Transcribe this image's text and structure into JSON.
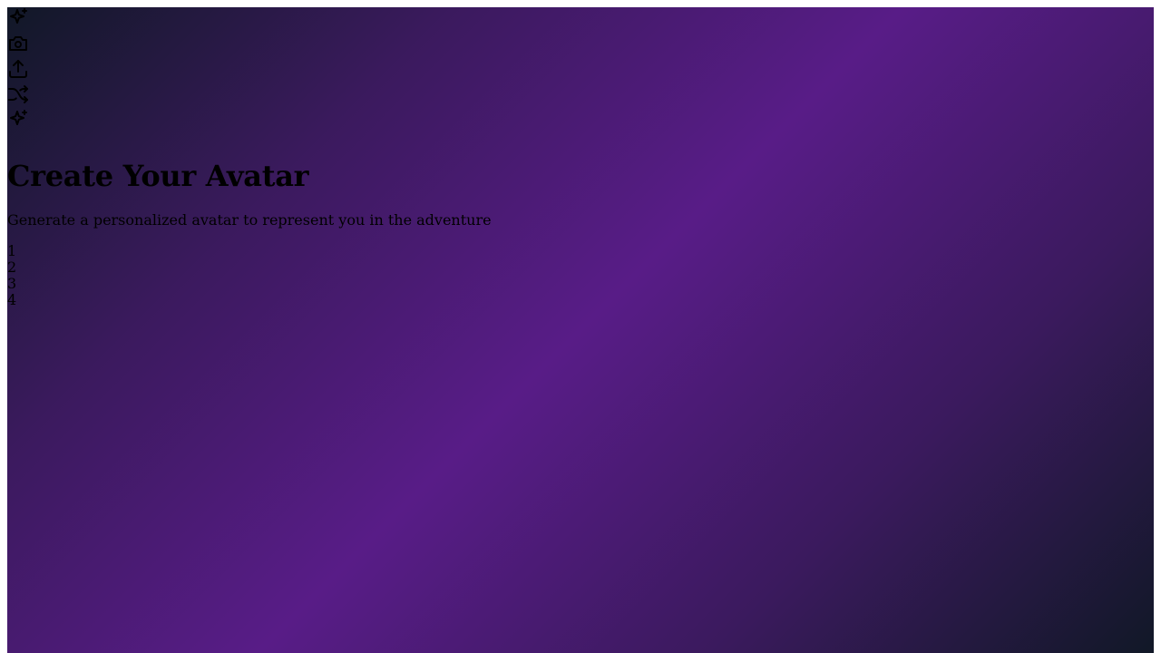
{
  "icons": [
    {
      "name": "sparkles-icon"
    },
    {
      "name": "camera-icon"
    },
    {
      "name": "upload-icon"
    },
    {
      "name": "shuffle-icon"
    },
    {
      "name": "sparkles-icon"
    }
  ],
  "header": {
    "title": "Create Your Avatar",
    "subtitle": "Generate a personalized avatar to represent you in the adventure"
  },
  "steps": [
    "1",
    "2",
    "3",
    "4"
  ],
  "colors": {
    "gradient_dark": "#111827",
    "gradient_purple": "#581c87",
    "text": "#000000"
  }
}
